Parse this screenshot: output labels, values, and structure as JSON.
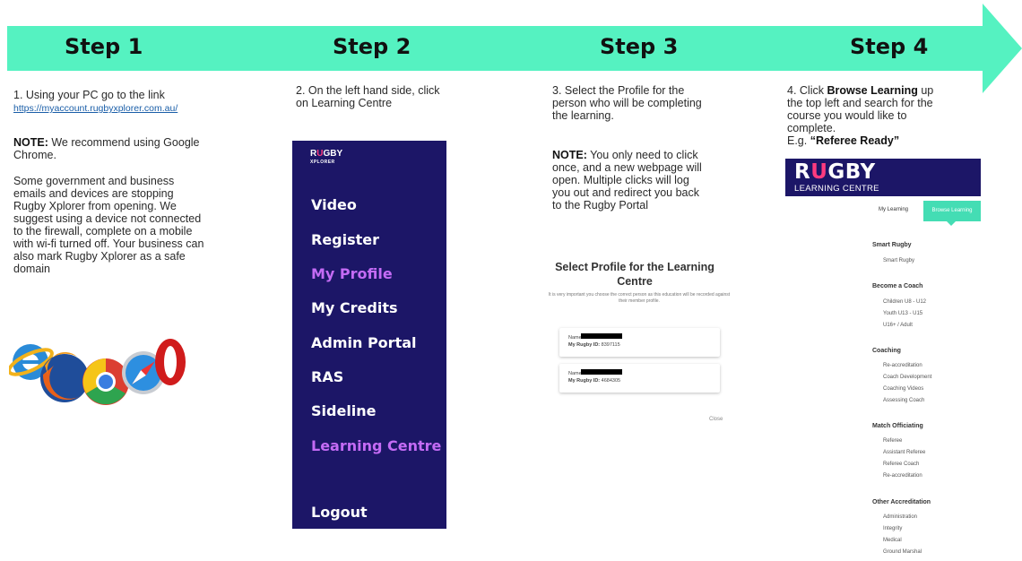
{
  "steps": [
    "Step 1",
    "Step 2",
    "Step 3",
    "Step 4"
  ],
  "step1": {
    "line1": "1. Using your PC go to the link",
    "link": "https://myaccount.rugbyxplorer.com.au/",
    "note_label": "NOTE:",
    "note_text": " We recommend using Google Chrome.",
    "para": "Some government and business emails and devices are stopping Rugby Xplorer from opening. We suggest using a device not connected to the firewall, complete on a mobile with wi-fi turned off. Your business can also mark Rugby Xplorer as a safe domain",
    "browser_icons": [
      "internet-explorer-icon",
      "firefox-icon",
      "chrome-icon",
      "safari-icon",
      "opera-icon"
    ]
  },
  "step2": {
    "instruction": "2. On the left hand side, click on Learning Centre",
    "logo_rugby_r": "R",
    "logo_rugby_u": "U",
    "logo_rugby_rest": "GBY",
    "logo_xplorer": "XPLORER",
    "menu": [
      {
        "label": "Video"
      },
      {
        "label": "Register"
      },
      {
        "label": "My Profile"
      },
      {
        "label": "My Credits"
      },
      {
        "label": "Admin Portal"
      },
      {
        "label": "RAS"
      },
      {
        "label": "Sideline"
      },
      {
        "label": "Learning Centre"
      },
      {
        "label": "Logout"
      }
    ],
    "colors": {
      "panel": "#1c1667",
      "highlight": "#c46bf5"
    }
  },
  "step3": {
    "instruction": "3. Select the Profile for the person who will be completing the learning.",
    "note_label": "NOTE:",
    "note_text": " You only need to click once, and a new webpage will open. Multiple clicks will log you out and redirect you back to the Rugby Portal",
    "dialog_title": "Select Profile for the Learning Centre",
    "dialog_sub": "It is very important you choose the correct person as this education will be recorded against their member profile.",
    "profiles": [
      {
        "name_label": "Name:",
        "id_label": "My Rugby ID:",
        "id": "8397115"
      },
      {
        "name_label": "Name:",
        "id_label": "My Rugby ID:",
        "id": "4684305"
      }
    ],
    "close": "Close"
  },
  "step4": {
    "instruction_a": "4. Click ",
    "instruction_bold": "Browse Learning",
    "instruction_b": " up the top left and search for the course you would like to complete.",
    "eg_label": "E.g. ",
    "eg_value": "“Referee Ready”",
    "banner_r": "R",
    "banner_u": "U",
    "banner_rest": "GBY",
    "banner_small": "LEARNING CENTRE",
    "tab_my_learning": "My Learning",
    "tab_browse": "Browse Learning",
    "categories": [
      {
        "title": "Smart Rugby",
        "items": [
          "Smart Rugby"
        ]
      },
      {
        "title": "Become a Coach",
        "items": [
          "Children U8 - U12",
          "Youth U13 - U15",
          "U16+ / Adult"
        ]
      },
      {
        "title": "Coaching",
        "items": [
          "Re-accreditation",
          "Coach Development",
          "Coaching Videos",
          "Assessing Coach"
        ]
      },
      {
        "title": "Match Officiating",
        "items": [
          "Referee",
          "Assistant Referee",
          "Referee Coach",
          "Re-accreditation"
        ]
      },
      {
        "title": "Other Accreditation",
        "items": [
          "Administration",
          "Integrity",
          "Medical",
          "Ground Marshal"
        ]
      }
    ],
    "colors": {
      "accent": "#44ddb4",
      "banner": "#1c1667"
    }
  },
  "colors": {
    "arrow": "#55f2c1"
  }
}
